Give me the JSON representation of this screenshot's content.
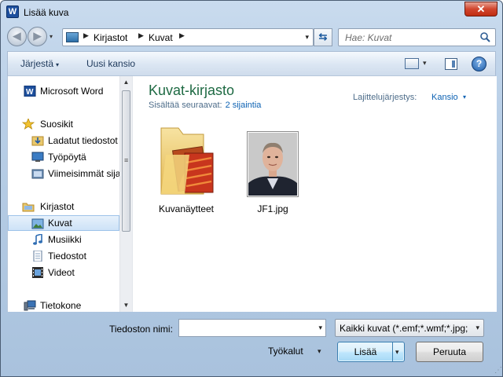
{
  "window": {
    "title": "Lisää kuva",
    "app_icon_letter": "W",
    "close_glyph": "✕"
  },
  "nav": {
    "back_glyph": "◀",
    "forward_glyph": "▶",
    "history_glyph": "▾",
    "breadcrumbs": [
      "Kirjastot",
      "Kuvat"
    ],
    "crumb_separator": "▶",
    "dropdown_glyph": "▾",
    "refresh_glyph": "⇆",
    "search_placeholder": "Hae: Kuvat"
  },
  "commandbar": {
    "organize_label": "Järjestä",
    "organize_arrow": "▾",
    "new_folder_label": "Uusi kansio",
    "view_dd_glyph": "▾",
    "help_glyph": "?"
  },
  "sidebar": {
    "items": [
      {
        "label": "Microsoft Word",
        "icon": "word-icon"
      },
      {
        "label": "Suosikit",
        "icon": "star-icon"
      },
      {
        "label": "Ladatut tiedostot",
        "icon": "downloads-folder-icon"
      },
      {
        "label": "Työpöytä",
        "icon": "desktop-icon"
      },
      {
        "label": "Viimeisimmät sijainnit",
        "icon": "recent-places-icon"
      },
      {
        "label": "Kirjastot",
        "icon": "libraries-icon"
      },
      {
        "label": "Kuvat",
        "icon": "pictures-icon",
        "selected": true
      },
      {
        "label": "Musiikki",
        "icon": "music-icon"
      },
      {
        "label": "Tiedostot",
        "icon": "documents-icon"
      },
      {
        "label": "Videot",
        "icon": "videos-icon"
      },
      {
        "label": "Tietokone",
        "icon": "computer-icon"
      }
    ],
    "scroll_up_glyph": "▲",
    "scroll_down_glyph": "▼",
    "scroll_grip_glyph": "≡"
  },
  "library": {
    "title": "Kuvat-kirjasto",
    "subtitle_prefix": "Sisältää seuraavat:",
    "locations_link": "2 sijaintia",
    "arrange_label": "Lajittelujärjestys:",
    "arrange_value": "Kansio",
    "arrange_arrow": "▾"
  },
  "files": [
    {
      "name": "Kuvanäytteet",
      "icon": "folder-icon"
    },
    {
      "name": "JF1.jpg",
      "icon": "photo-thumbnail-icon"
    }
  ],
  "footer": {
    "filename_label": "Tiedoston nimi:",
    "filename_value": "",
    "dropdown_glyph": "▾",
    "filetype_value": "Kaikki kuvat (*.emf;*.wmf;*.jpg;",
    "tools_label": "Työkalut",
    "insert_label": "Lisää",
    "cancel_label": "Peruuta",
    "resize_grip_glyph": "⋰"
  },
  "colors": {
    "accent_title": "#1e6a43",
    "link": "#0d62b3",
    "close_red": "#c02d12",
    "selection": "#cde2f7"
  }
}
